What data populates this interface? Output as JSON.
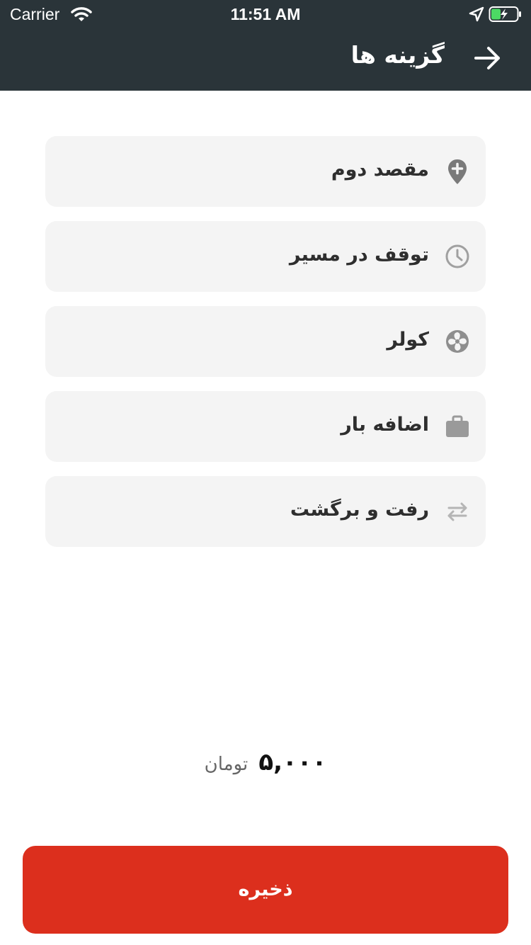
{
  "status_bar": {
    "carrier": "Carrier",
    "time": "11:51 AM"
  },
  "header": {
    "title": "گزینه ها",
    "back_icon": "arrow-right-icon"
  },
  "options": [
    {
      "label": "مقصد دوم",
      "icon": "location-plus-icon"
    },
    {
      "label": "توقف در مسیر",
      "icon": "clock-icon"
    },
    {
      "label": "کولر",
      "icon": "fan-icon"
    },
    {
      "label": "اضافه بار",
      "icon": "briefcase-icon"
    },
    {
      "label": "رفت و برگشت",
      "icon": "swap-arrows-icon"
    }
  ],
  "price": {
    "amount": "۵,۰۰۰",
    "currency": "تومان"
  },
  "save_button": {
    "label": "ذخیره"
  },
  "colors": {
    "header_bg": "#2a3439",
    "option_bg": "#f4f4f4",
    "save_bg": "#dc2f1d",
    "icon_gray": "#7a7a7a",
    "battery_green": "#4cd964"
  }
}
